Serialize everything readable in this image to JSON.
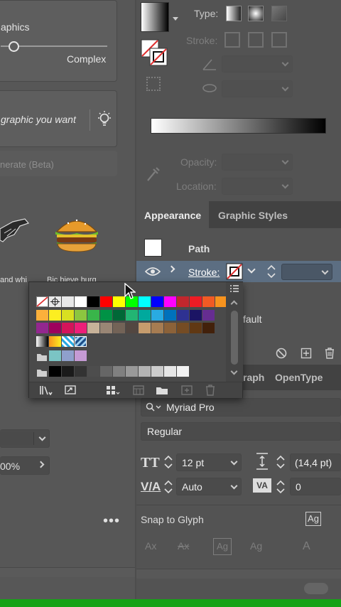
{
  "left_panel": {
    "graphics_label": "aphics",
    "complex_label": "Complex",
    "prompt_placeholder": "graphic you want",
    "generate_label": "nerate (Beta)",
    "thumb1_caption": "and whi",
    "thumb2_caption": "Bic bieve burg",
    "percent_value": "00%"
  },
  "gradient": {
    "type_label": "Type:",
    "stroke_label": "Stroke:",
    "opacity_label": "Opacity:",
    "location_label": "Location:"
  },
  "appearance": {
    "tab_appearance": "Appearance",
    "tab_graphic_styles": "Graphic Styles",
    "path_label": "Path",
    "stroke_label": "Stroke:",
    "default_partial": "fault"
  },
  "character": {
    "tab_graph": "raph",
    "tab_opentype": "OpenType",
    "font_family": "Myriad Pro",
    "font_style": "Regular",
    "font_size": "12 pt",
    "leading": "(14,4 pt)",
    "kerning": "Auto",
    "tracking": "0",
    "snap_to_glyph": "Snap to Glyph"
  },
  "swatches": {
    "rows": [
      [
        "#e8e8e8",
        "#ffffff",
        "#000000",
        "#ff0000",
        "#ffff00",
        "#00ff00",
        "#00ffff",
        "#0000ff",
        "#ff00ff",
        "#c1272d",
        "#ed1c24",
        "#f15a24",
        "#f7931e"
      ],
      [
        "#fbb03b",
        "#fcee21",
        "#d9e021",
        "#8cc63f",
        "#39b54a",
        "#009245",
        "#006837",
        "#22b573",
        "#00a99d",
        "#29abe2",
        "#0071bc",
        "#2e3192",
        "#1b1464",
        "#662d91"
      ],
      [
        "#93278f",
        "#9e005d",
        "#d4145a",
        "#ed1e79",
        "#c7b299",
        "#998675",
        "#736357",
        "#534741",
        "#c69c6d",
        "#a67c52",
        "#8c6239",
        "#754c24",
        "#603813",
        "#42210b"
      ]
    ],
    "gray_row": [
      "#000000",
      "#1a1a1a",
      "#333333",
      "#4d4d4d",
      "#666666",
      "#808080",
      "#999999",
      "#b3b3b3",
      "#cccccc",
      "#e6e6e6",
      "#f2f2f2"
    ],
    "colors": {
      "accent_red": "#e03030",
      "selected_row": "#5c6e82",
      "bottom_bar": "#16a216"
    }
  }
}
